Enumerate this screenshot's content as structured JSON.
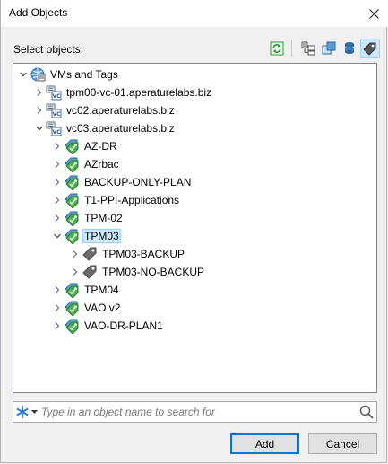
{
  "dialog": {
    "title": "Add Objects",
    "select_label": "Select objects:"
  },
  "toolbar": {
    "icons": [
      "refresh-icon",
      "hosts-and-clusters-icon",
      "vms-and-templates-icon",
      "datastores-icon",
      "tags-icon"
    ],
    "active": "tags-icon"
  },
  "tree": {
    "root": "VMs and Tags",
    "vcenters": [
      "tpm00-vc-01.aperaturelabs.biz",
      "vc02.aperaturelabs.biz",
      "vc03.aperaturelabs.biz"
    ],
    "categories": [
      "AZ-DR",
      "AZrbac",
      "BACKUP-ONLY-PLAN",
      "T1-PPI-Applications",
      "TPM-02",
      "TPM03",
      "TPM04",
      "VAO v2",
      "VAO-DR-PLAN1"
    ],
    "tags": [
      "TPM03-BACKUP",
      "TPM03-NO-BACKUP"
    ],
    "selected": "TPM03"
  },
  "search": {
    "placeholder": "Type in an object name to search for",
    "value": ""
  },
  "buttons": {
    "add": "Add",
    "cancel": "Cancel"
  },
  "colors": {
    "accent": "#0078d7",
    "selection_bg": "#cce8ff",
    "selection_border": "#99d1ff",
    "tag_green": "#3aa53a",
    "tag_gray": "#6d6d6d"
  }
}
